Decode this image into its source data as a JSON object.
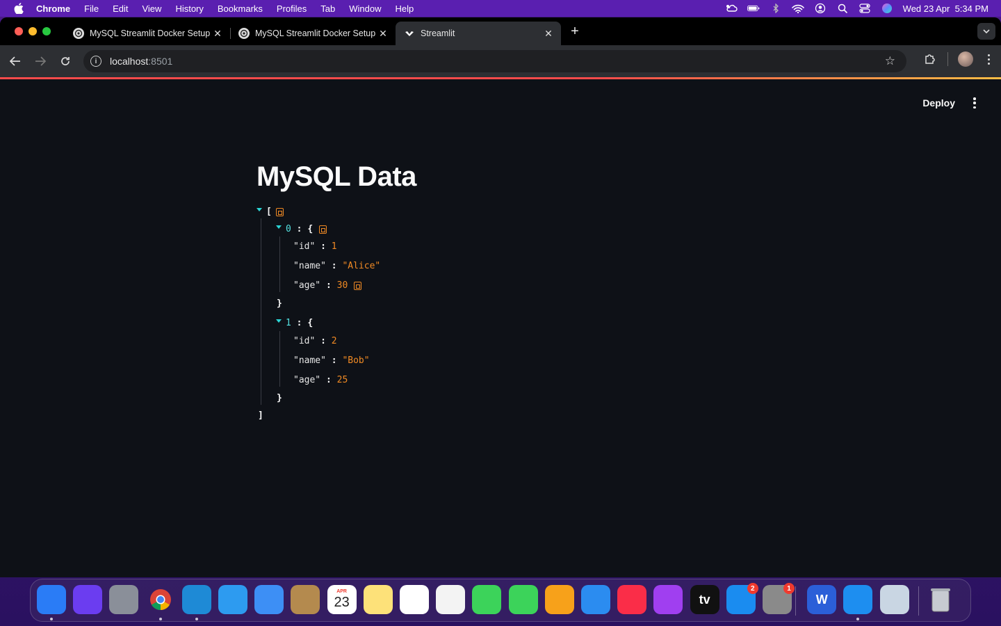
{
  "menubar": {
    "app": "Chrome",
    "items": [
      "File",
      "Edit",
      "View",
      "History",
      "Bookmarks",
      "Profiles",
      "Tab",
      "Window",
      "Help"
    ],
    "datetime": "Wed 23 Apr  5:34 PM",
    "status_icons": [
      "cloud-weather-icon",
      "battery-icon",
      "bluetooth-icon",
      "wifi-icon",
      "user-icon",
      "spotlight-search-icon",
      "control-center-icon",
      "siri-icon"
    ]
  },
  "browser": {
    "tabs": [
      {
        "title": "MySQL Streamlit Docker Setup",
        "icon": "openai-icon",
        "active": false
      },
      {
        "title": "MySQL Streamlit Docker Setup",
        "icon": "openai-icon",
        "active": false
      },
      {
        "title": "Streamlit",
        "icon": "streamlit-icon",
        "active": true
      }
    ],
    "url_host": "localhost",
    "url_port": ":8501"
  },
  "streamlit": {
    "deploy_label": "Deploy",
    "title": "MySQL Data",
    "json": {
      "open_bracket": "[",
      "close_bracket": "]",
      "records": [
        {
          "index": "0",
          "id": "1",
          "name": "\"Alice\"",
          "age": "30"
        },
        {
          "index": "1",
          "id": "2",
          "name": "\"Bob\"",
          "age": "25"
        }
      ],
      "keys": {
        "id": "\"id\"",
        "name": "\"name\"",
        "age": "\"age\""
      },
      "open_brace": "{",
      "close_brace": "}",
      "colon": ":"
    }
  },
  "dock": {
    "items": [
      {
        "name": "finder",
        "color": "#2a7cf6",
        "running": true
      },
      {
        "name": "siri",
        "color": "#6b3df0",
        "running": false
      },
      {
        "name": "launchpad",
        "color": "#8a8f99",
        "running": false
      },
      {
        "name": "chrome",
        "color": "#e8e8e8",
        "running": true
      },
      {
        "name": "vscode",
        "color": "#1e8ad6",
        "running": true
      },
      {
        "name": "safari",
        "color": "#2d9bf0",
        "running": false
      },
      {
        "name": "mail",
        "color": "#3d8ff5",
        "running": false
      },
      {
        "name": "contacts",
        "color": "#b48a4e",
        "running": false
      },
      {
        "name": "calendar",
        "color": "#ffffff",
        "running": false,
        "month": "APR",
        "day": "23"
      },
      {
        "name": "notes",
        "color": "#fde179",
        "running": false
      },
      {
        "name": "reminders",
        "color": "#ffffff",
        "running": false
      },
      {
        "name": "photos",
        "color": "#f3f3f3",
        "running": false
      },
      {
        "name": "messages",
        "color": "#3cd35a",
        "running": false
      },
      {
        "name": "facetime",
        "color": "#3cd35a",
        "running": false
      },
      {
        "name": "pages",
        "color": "#f7a11a",
        "running": false
      },
      {
        "name": "keynote",
        "color": "#2b8cf0",
        "running": false
      },
      {
        "name": "music",
        "color": "#fa2d48",
        "running": false
      },
      {
        "name": "podcasts",
        "color": "#a03ff0",
        "running": false
      },
      {
        "name": "apple-tv",
        "color": "#111111",
        "running": false,
        "label": "tv"
      },
      {
        "name": "app-store",
        "color": "#1a8cf0",
        "running": false,
        "badge": "2"
      },
      {
        "name": "system-settings",
        "color": "#8a8a8a",
        "running": false,
        "badge": "1"
      },
      {
        "name": "word",
        "color": "#2b5fd8",
        "running": false,
        "label": "W"
      },
      {
        "name": "docker",
        "color": "#1d8ef0",
        "running": true
      },
      {
        "name": "preview",
        "color": "#c9d6e3",
        "running": false
      },
      {
        "name": "trash",
        "color": "#9aa0a6",
        "running": false
      }
    ]
  }
}
